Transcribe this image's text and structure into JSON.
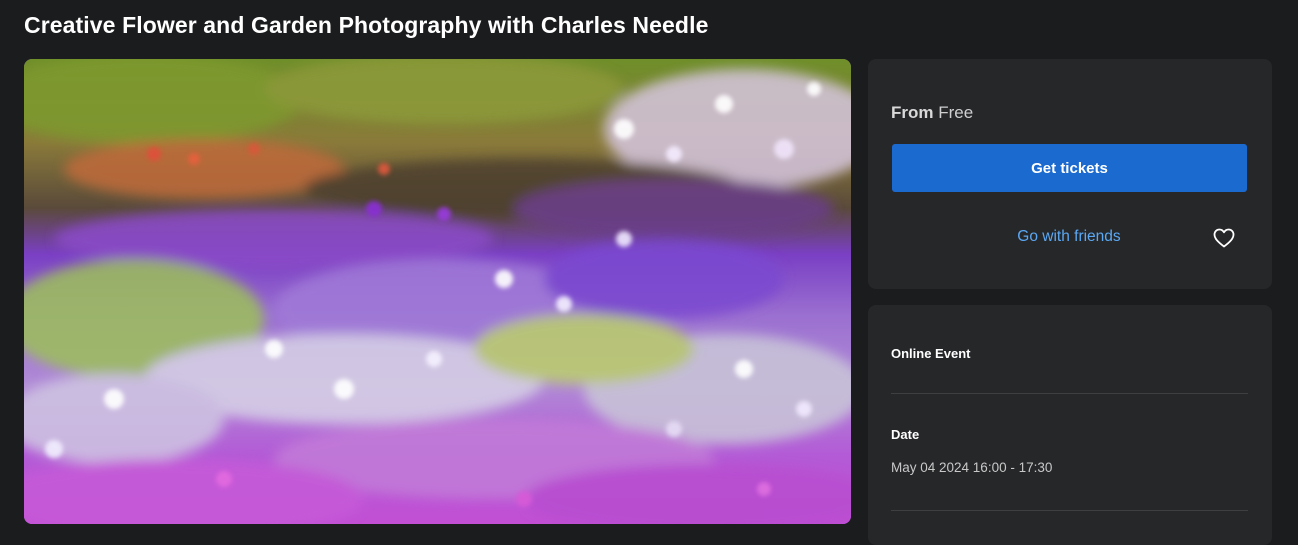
{
  "event": {
    "title": "Creative Flower and Garden Photography with Charles Needle",
    "hero_alt": "Impressionistic flower field photograph in purple, white and green"
  },
  "tickets": {
    "price_prefix": "From",
    "price_value": "Free",
    "get_tickets_label": "Get tickets",
    "go_with_friends_label": "Go with friends",
    "favorite_icon": "heart-icon"
  },
  "info": {
    "location_label": "Online Event",
    "date_label": "Date",
    "date_value": "May 04 2024 16:00 - 17:30"
  },
  "colors": {
    "background": "#1b1c1e",
    "card": "#262729",
    "primary_button": "#1a6ad0",
    "link": "#5ba8f4"
  }
}
